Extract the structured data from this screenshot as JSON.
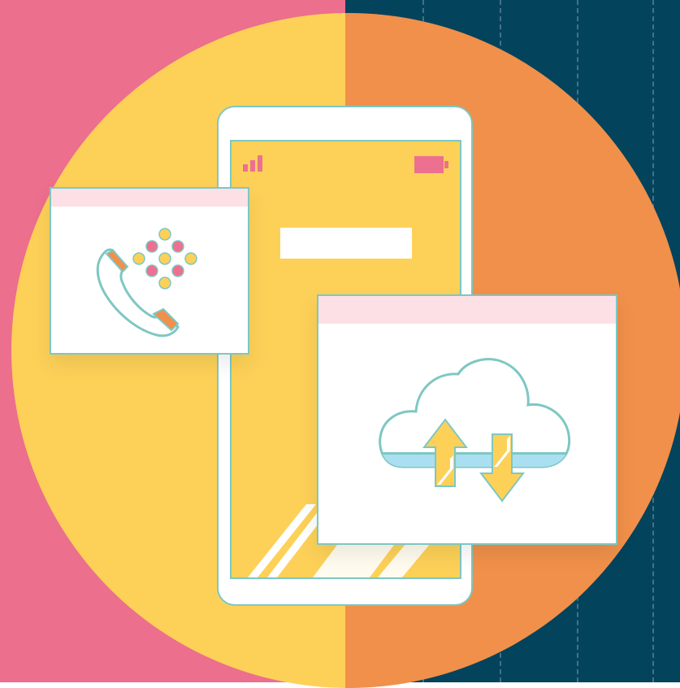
{
  "colors": {
    "background_left": "#ec6f8d",
    "background_right": "#04435c",
    "circle_left": "#fdd158",
    "circle_right": "#f0904a",
    "outline": "#7ec7c3",
    "pink_light": "#fde0e6",
    "pink": "#ee7090",
    "yellow": "#fdd158",
    "orange": "#f0904a",
    "light_blue": "#a9dff0",
    "white": "#ffffff"
  },
  "icons": {
    "phone_device": "smartphone-icon",
    "signal": "signal-bars-icon",
    "battery": "battery-icon",
    "call": "telephone-handset-icon",
    "keypad": "keypad-dots-icon",
    "cloud": "cloud-icon",
    "upload": "arrow-up-icon",
    "download": "arrow-down-icon"
  }
}
